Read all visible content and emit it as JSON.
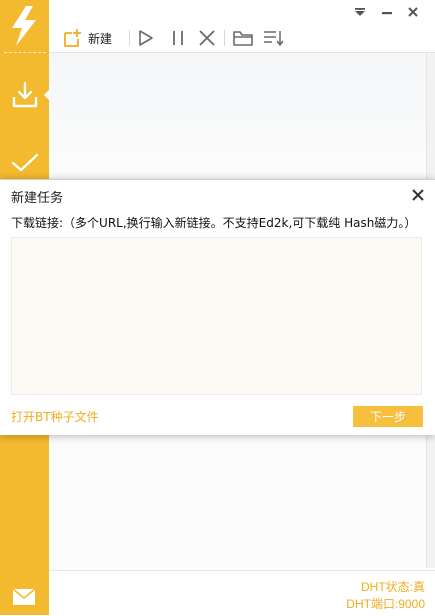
{
  "app": {
    "sidebar": {
      "items": [
        {
          "icon": "download-icon",
          "active": true
        },
        {
          "icon": "completed-check-icon",
          "active": false
        }
      ],
      "bottom_icon": "mail-icon"
    },
    "titlebar": {
      "controls": [
        "menu-dropdown-icon",
        "minimize-icon",
        "close-icon"
      ]
    },
    "toolbar": {
      "new_label": "新建",
      "buttons": [
        "new-task-icon",
        "start-icon",
        "pause-icon",
        "delete-icon",
        "open-folder-icon",
        "sort-icon"
      ]
    },
    "status": {
      "dht_state": "DHT状态:真",
      "dht_port": "DHT端口:9000"
    }
  },
  "dialog": {
    "title": "新建任务",
    "hint": "下载链接:（多个URL,换行输入新链接。不支持Ed2k,可下载纯 Hash磁力。）",
    "textarea_value": "",
    "open_torrent_label": "打开BT种子文件",
    "next_label": "下一步"
  },
  "colors": {
    "accent": "#f3b92f",
    "accent_text": "#f0ad1e",
    "button": "#f6bf3d",
    "textarea_bg": "#fdfaf3"
  }
}
